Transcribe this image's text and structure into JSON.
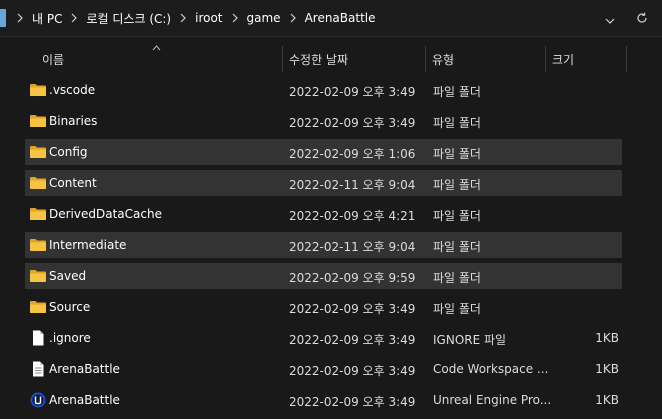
{
  "address": {
    "crumbs": [
      "내 PC",
      "로컬 디스크 (C:)",
      "iroot",
      "game",
      "ArenaBattle"
    ]
  },
  "columns": {
    "name": "이름",
    "date": "수정한 날짜",
    "type": "유형",
    "size": "크기"
  },
  "files": [
    {
      "name": ".vscode",
      "date": "2022-02-09 오후 3:49",
      "type": "파일 폴더",
      "size": "",
      "icon": "folder-icon",
      "selected": false
    },
    {
      "name": "Binaries",
      "date": "2022-02-09 오후 3:49",
      "type": "파일 폴더",
      "size": "",
      "icon": "folder-icon",
      "selected": false
    },
    {
      "name": "Config",
      "date": "2022-02-09 오후 1:06",
      "type": "파일 폴더",
      "size": "",
      "icon": "folder-icon",
      "selected": true
    },
    {
      "name": "Content",
      "date": "2022-02-11 오후 9:04",
      "type": "파일 폴더",
      "size": "",
      "icon": "folder-icon",
      "selected": true
    },
    {
      "name": "DerivedDataCache",
      "date": "2022-02-09 오후 4:21",
      "type": "파일 폴더",
      "size": "",
      "icon": "folder-icon",
      "selected": false
    },
    {
      "name": "Intermediate",
      "date": "2022-02-11 오후 9:04",
      "type": "파일 폴더",
      "size": "",
      "icon": "folder-icon",
      "selected": true
    },
    {
      "name": "Saved",
      "date": "2022-02-09 오후 9:59",
      "type": "파일 폴더",
      "size": "",
      "icon": "folder-icon",
      "selected": true
    },
    {
      "name": "Source",
      "date": "2022-02-09 오후 3:49",
      "type": "파일 폴더",
      "size": "",
      "icon": "folder-icon",
      "selected": false
    },
    {
      "name": ".ignore",
      "date": "2022-02-09 오후 3:49",
      "type": "IGNORE 파일",
      "size": "1KB",
      "icon": "file-icon",
      "selected": false
    },
    {
      "name": "ArenaBattle",
      "date": "2022-02-09 오후 3:49",
      "type": "Code Workspace ...",
      "size": "1KB",
      "icon": "text-file-icon",
      "selected": false
    },
    {
      "name": "ArenaBattle",
      "date": "2022-02-09 오후 3:49",
      "type": "Unreal Engine Pro...",
      "size": "1KB",
      "icon": "unreal-engine-icon",
      "selected": false
    }
  ],
  "colors": {
    "background": "#191919",
    "selected_row": "#333333",
    "folder": "#f6c342",
    "folder_dark": "#e0a527"
  }
}
